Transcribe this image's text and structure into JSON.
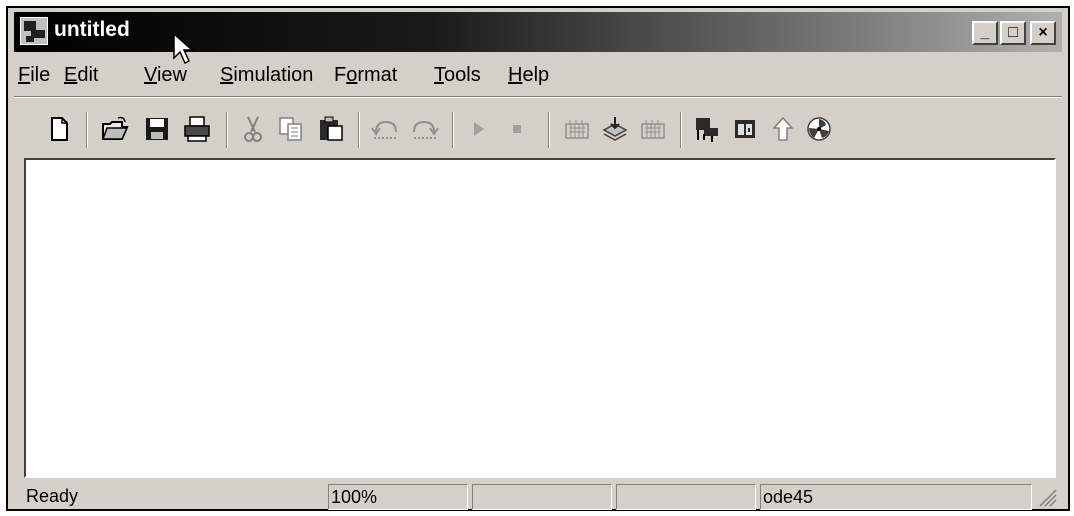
{
  "window": {
    "title": "untitled",
    "controls": {
      "minimize": "_",
      "maximize": "□",
      "close": "×"
    }
  },
  "menu": {
    "items": [
      {
        "label": "File",
        "mnemonic": "F"
      },
      {
        "label": "Edit",
        "mnemonic": "E"
      },
      {
        "label": "View",
        "mnemonic": "V"
      },
      {
        "label": "Simulation",
        "mnemonic": "S"
      },
      {
        "label": "Format",
        "mnemonic": "o"
      },
      {
        "label": "Tools",
        "mnemonic": "T"
      },
      {
        "label": "Help",
        "mnemonic": "H"
      }
    ]
  },
  "toolbar": {
    "buttons": [
      {
        "icon": "new-document-icon"
      },
      {
        "icon": "open-folder-icon"
      },
      {
        "icon": "save-icon"
      },
      {
        "icon": "print-icon"
      },
      {
        "icon": "cut-icon"
      },
      {
        "icon": "copy-icon"
      },
      {
        "icon": "paste-icon"
      },
      {
        "icon": "undo-icon"
      },
      {
        "icon": "redo-icon"
      },
      {
        "icon": "start-simulation-icon"
      },
      {
        "icon": "stop-simulation-icon"
      },
      {
        "icon": "build-icon"
      },
      {
        "icon": "update-diagram-icon"
      },
      {
        "icon": "build-subsystem-icon"
      },
      {
        "icon": "library-browser-icon"
      },
      {
        "icon": "model-explorer-icon"
      },
      {
        "icon": "go-to-parent-icon"
      },
      {
        "icon": "debug-icon"
      }
    ]
  },
  "status": {
    "state": "Ready",
    "zoom": "100%",
    "pane3": "",
    "pane4": "",
    "solver": "ode45"
  }
}
